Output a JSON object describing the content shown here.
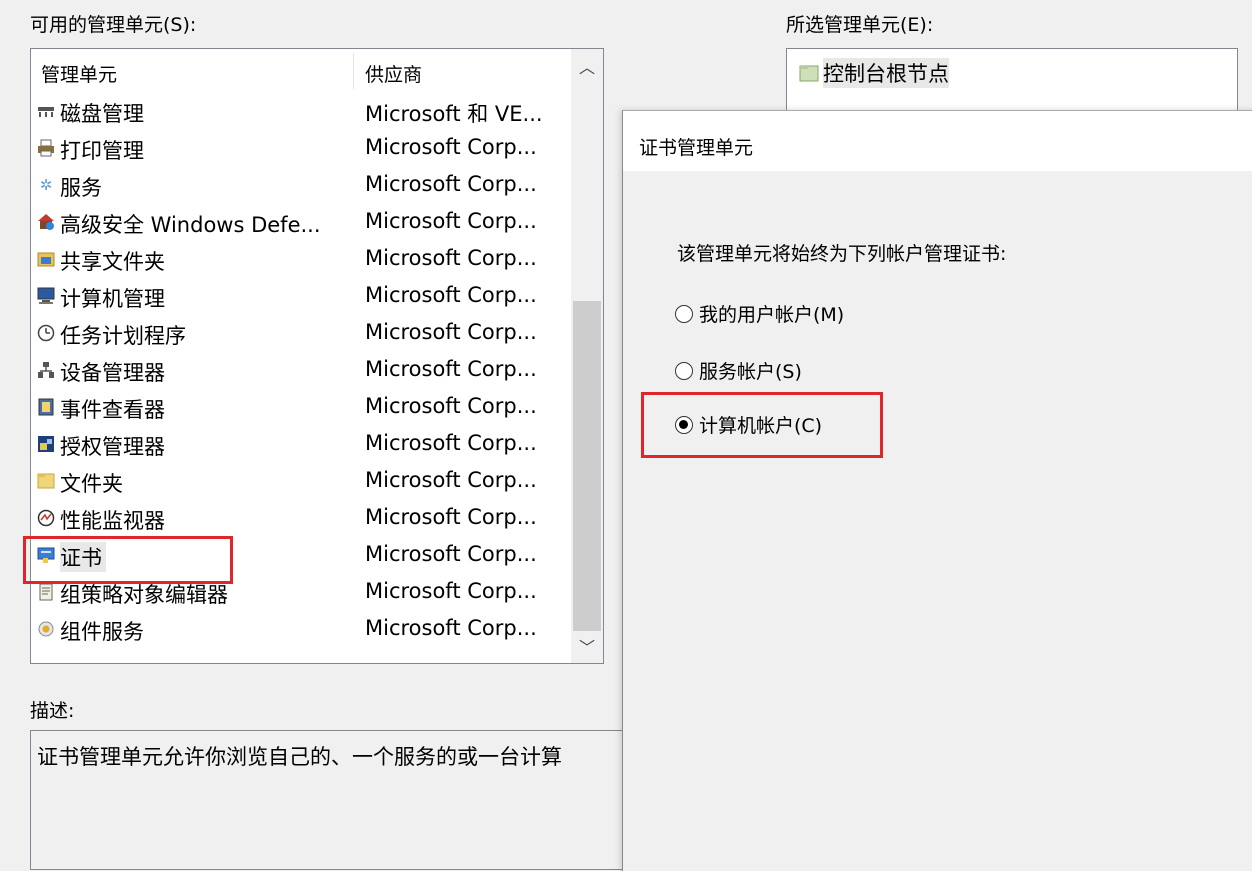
{
  "available_label": "可用的管理单元(S):",
  "selected_label": "所选管理单元(E):",
  "description_label": "描述:",
  "description_text": "证书管理单元允许你浏览自己的、一个服务的或一台计算",
  "columns": {
    "name": "管理单元",
    "vendor": "供应商"
  },
  "snapins": [
    {
      "name": "磁盘管理",
      "vendor": "Microsoft 和 VE...",
      "icon": "disk-icon"
    },
    {
      "name": "打印管理",
      "vendor": "Microsoft Corp...",
      "icon": "printer-icon"
    },
    {
      "name": "服务",
      "vendor": "Microsoft Corp...",
      "icon": "gear-icon"
    },
    {
      "name": "高级安全 Windows Defe...",
      "vendor": "Microsoft Corp...",
      "icon": "firewall-icon"
    },
    {
      "name": "共享文件夹",
      "vendor": "Microsoft Corp...",
      "icon": "shared-folder-icon"
    },
    {
      "name": "计算机管理",
      "vendor": "Microsoft Corp...",
      "icon": "computer-icon"
    },
    {
      "name": "任务计划程序",
      "vendor": "Microsoft Corp...",
      "icon": "clock-icon"
    },
    {
      "name": "设备管理器",
      "vendor": "Microsoft Corp...",
      "icon": "device-icon"
    },
    {
      "name": "事件查看器",
      "vendor": "Microsoft Corp...",
      "icon": "event-log-icon"
    },
    {
      "name": "授权管理器",
      "vendor": "Microsoft Corp...",
      "icon": "authorization-icon"
    },
    {
      "name": "文件夹",
      "vendor": "Microsoft Corp...",
      "icon": "folder-icon"
    },
    {
      "name": "性能监视器",
      "vendor": "Microsoft Corp...",
      "icon": "performance-icon"
    },
    {
      "name": "证书",
      "vendor": "Microsoft Corp...",
      "icon": "certificate-icon"
    },
    {
      "name": "组策略对象编辑器",
      "vendor": "Microsoft Corp...",
      "icon": "policy-icon"
    },
    {
      "name": "组件服务",
      "vendor": "Microsoft Corp...",
      "icon": "component-icon"
    }
  ],
  "selected_snapins": [
    {
      "name": "控制台根节点",
      "icon": "folder-icon"
    }
  ],
  "dialog": {
    "title": "证书管理单元",
    "prompt": "该管理单元将始终为下列帐户管理证书:",
    "options": [
      {
        "label": "我的用户帐户(M)",
        "checked": false
      },
      {
        "label": "服务帐户(S)",
        "checked": false
      },
      {
        "label": "计算机帐户(C)",
        "checked": true
      }
    ]
  },
  "colors": {
    "highlight": "#e0262b"
  }
}
